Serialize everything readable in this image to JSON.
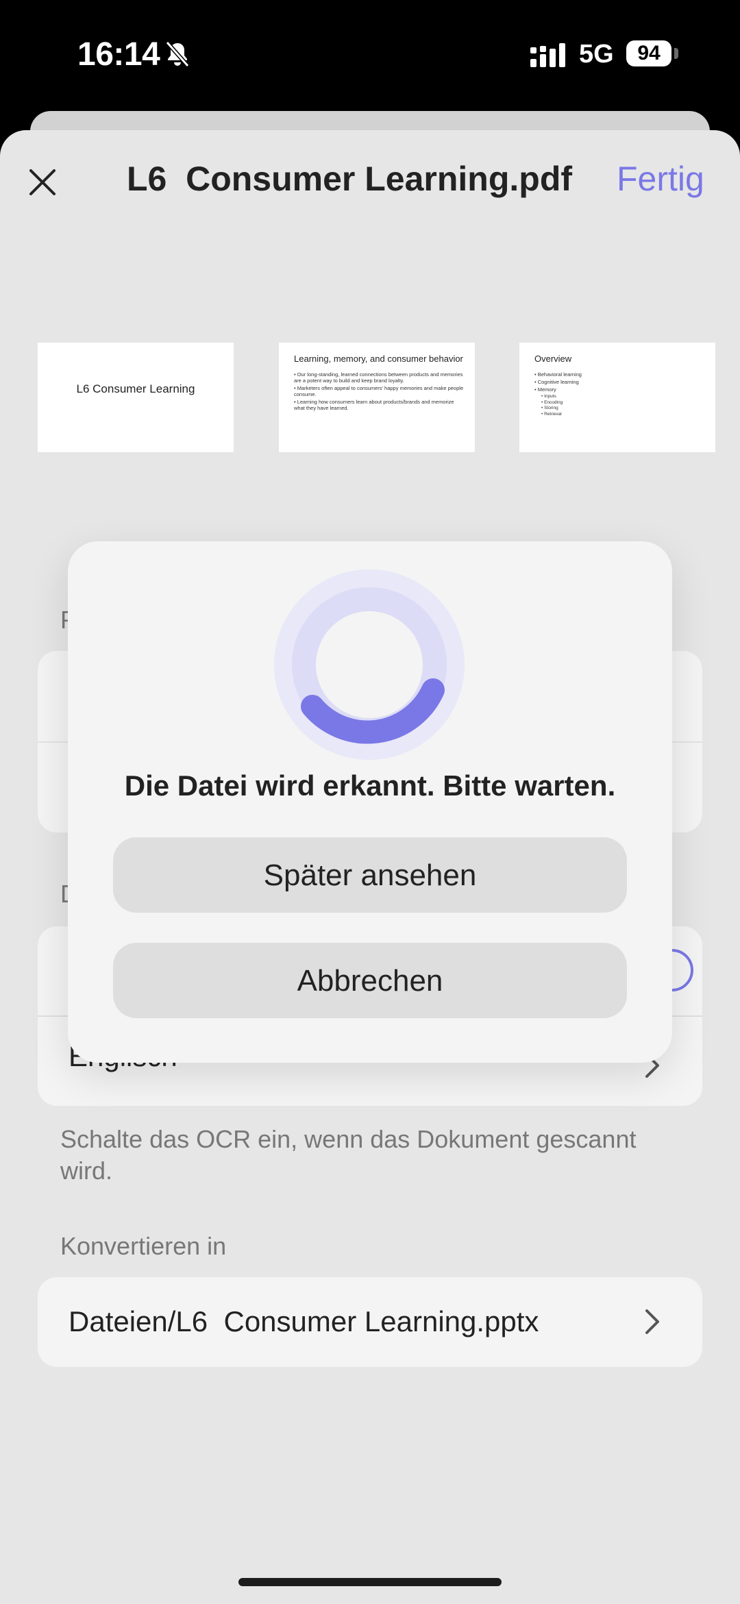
{
  "status_bar": {
    "time": "16:14",
    "network": "5G",
    "battery": "94",
    "icons": [
      "bell-slash-icon",
      "signal-icon"
    ]
  },
  "header": {
    "title": "L6  Consumer Learning.pdf",
    "done_label": "Fertig",
    "close_icon": "close-icon"
  },
  "thumbnails": [
    {
      "title": "L6 Consumer Learning"
    },
    {
      "title": "Learning, memory, and consumer behavior",
      "bullets": [
        "Our long-standing, learned connections between products and memories are a potent way to build and keep brand loyalty.",
        "Marketers often appeal to consumers' happy memories and make people consume.",
        "Learning how consumers learn about products/brands and memorize what they have learned."
      ]
    },
    {
      "title": "Overview",
      "bullets": [
        "Behavioral learning",
        "Cognitive learning",
        "Memory"
      ],
      "sub_bullets": [
        "Inputs",
        "Encoding",
        "Storing",
        "Retrieval"
      ]
    }
  ],
  "partial_labels": {
    "section_1": "P",
    "section_2": "D",
    "language_row": "Englisch"
  },
  "ocr_help": "Schalte das OCR ein, wenn das Dokument gescannt wird.",
  "convert": {
    "label": "Konvertieren in",
    "path": "Dateien/L6  Consumer Learning.pptx"
  },
  "dialog": {
    "message": "Die Datei wird erkannt. Bitte warten.",
    "later_button": "Später ansehen",
    "cancel_button": "Abbrechen"
  },
  "colors": {
    "accent": "#7a78e6",
    "sheet_background": "#e6e6e6",
    "card_background": "#f4f4f4",
    "button_background": "#dedede"
  }
}
